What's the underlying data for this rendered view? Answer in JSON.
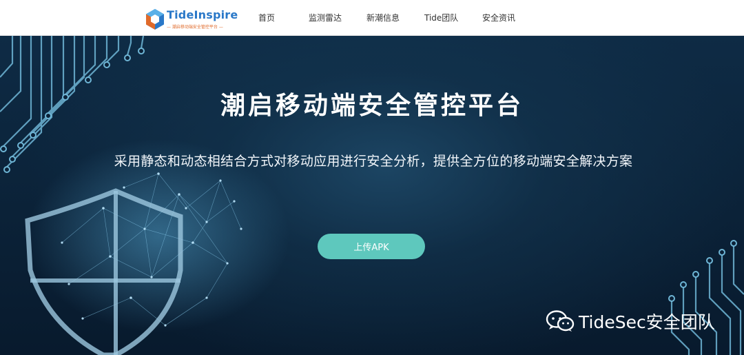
{
  "nav": {
    "logo": {
      "name": "TideInspire",
      "subtitle": "— 潮启移动端安全管控平台 —"
    },
    "items": [
      {
        "label": "首页"
      },
      {
        "label": "监测雷达"
      },
      {
        "label": "新潮信息"
      },
      {
        "label": "Tide团队"
      },
      {
        "label": "安全资讯"
      }
    ]
  },
  "hero": {
    "title": "潮启移动端安全管控平台",
    "subtitle": "采用静态和动态相结合方式对移动应用进行安全分析，提供全方位的移动端安全解决方案",
    "upload_label": "上传APK"
  },
  "watermark": {
    "text": "TideSec安全团队",
    "icon": "wechat-icon"
  },
  "colors": {
    "nav_bg": "#ffffff",
    "hero_bg": "#0b2238",
    "button": "#5ec8bd",
    "circuit": "#6fb6d6",
    "logo_blue": "#2a78c8",
    "logo_orange": "#e06a2a"
  }
}
